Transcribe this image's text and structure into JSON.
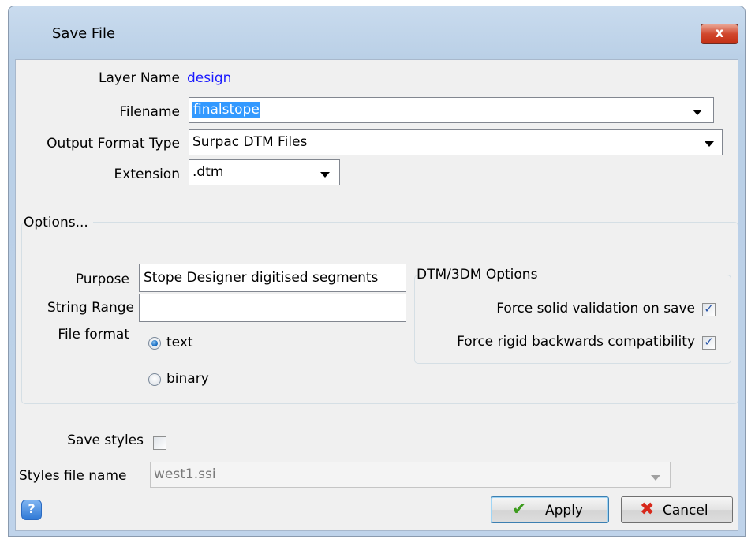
{
  "dialog": {
    "title": "Save File",
    "close_label": "x"
  },
  "form": {
    "layer_name_label": "Layer Name",
    "layer_name_value": "design",
    "filename_label": "Filename",
    "filename_value": "finalstope",
    "output_format_label": "Output Format Type",
    "output_format_value": "Surpac DTM Files",
    "extension_label": "Extension",
    "extension_value": ".dtm"
  },
  "options": {
    "title": "Options...",
    "purpose_label": "Purpose",
    "purpose_value": "Stope Designer digitised segments",
    "string_range_label": "String Range",
    "string_range_value": "",
    "file_format_label": "File format",
    "format_options": [
      {
        "label": "text",
        "selected": true
      },
      {
        "label": "binary",
        "selected": false
      }
    ],
    "dtm": {
      "title": "DTM/3DM Options",
      "force_solid_label": "Force solid validation on save",
      "force_solid_checked": true,
      "force_rigid_label": "Force rigid backwards compatibility",
      "force_rigid_checked": true
    }
  },
  "styles": {
    "save_styles_label": "Save styles",
    "save_styles_checked": false,
    "styles_file_label": "Styles file name",
    "styles_file_value": "west1.ssi"
  },
  "buttons": {
    "help_icon": "question-icon",
    "apply_label": "Apply",
    "apply_icon": "checkmark-icon",
    "cancel_label": "Cancel",
    "cancel_icon": "red-x-icon"
  },
  "colors": {
    "layer_name_value": "#1a1aff",
    "selection": "#3399ff"
  }
}
